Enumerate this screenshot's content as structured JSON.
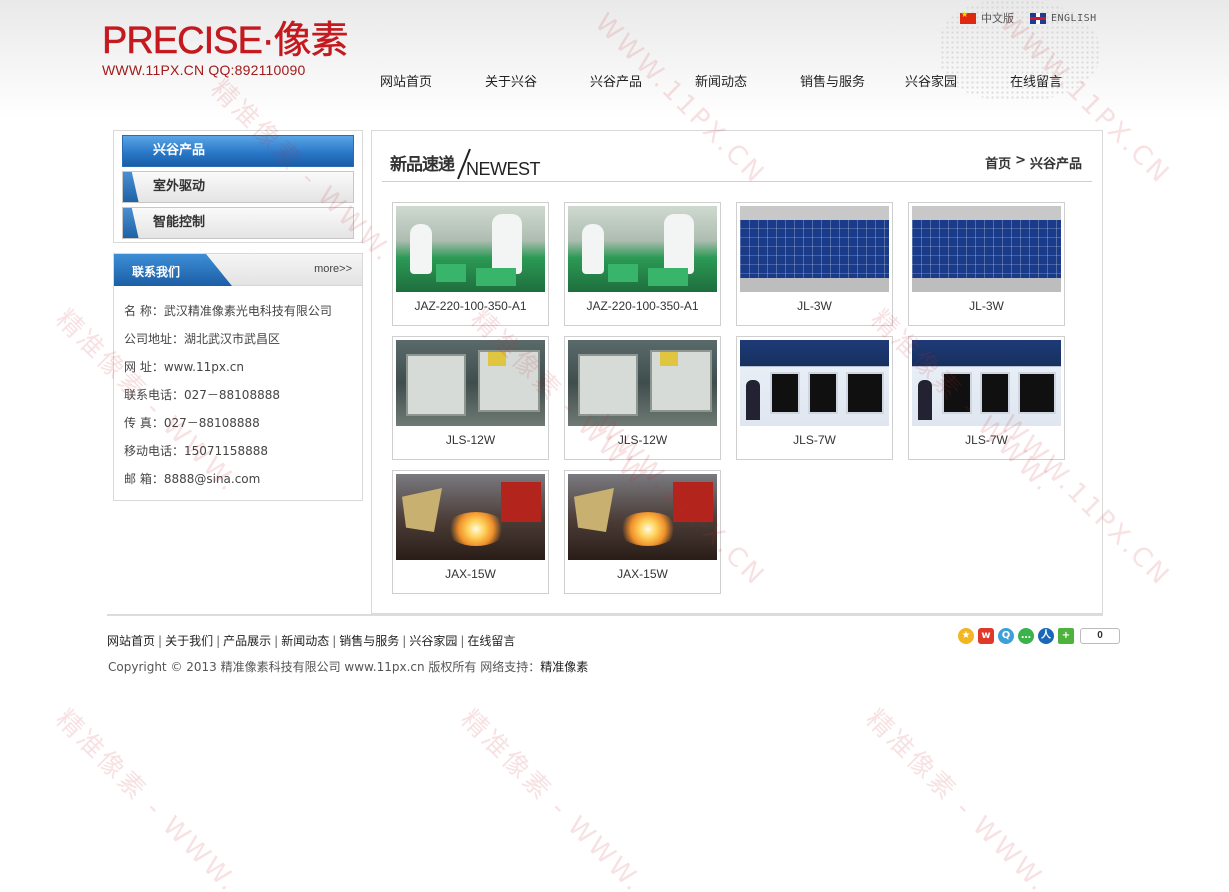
{
  "logo": {
    "title": "PRECISE·像素",
    "subtitle": "WWW.11PX.CN QQ:892110090"
  },
  "lang": {
    "cn": "中文版",
    "en": "ENGLISH"
  },
  "nav": [
    {
      "label": "网站首页"
    },
    {
      "label": "关于兴谷"
    },
    {
      "label": "兴谷产品"
    },
    {
      "label": "新闻动态"
    },
    {
      "label": "销售与服务"
    },
    {
      "label": "兴谷家园"
    },
    {
      "label": "在线留言"
    }
  ],
  "sidebar": {
    "products": [
      {
        "label": "兴谷产品",
        "active": true
      },
      {
        "label": "室外驱动",
        "active": false
      },
      {
        "label": "智能控制",
        "active": false
      }
    ],
    "contact": {
      "title": "联系我们",
      "more": "more>>",
      "lines": [
        "名 称：武汉精准像素光电科技有限公司",
        "公司地址：湖北武汉市武昌区",
        "网 址：www.11px.cn",
        "联系电话：027－88108888",
        "传 真：027－88108888",
        "移动电话：15071158888",
        "邮 箱：8888@sina.com"
      ]
    }
  },
  "main": {
    "title_cn": "新品速递",
    "title_en": "NEWEST",
    "breadcrumb": {
      "home": "首页",
      "sep": ">",
      "current": "兴谷产品"
    },
    "products": [
      {
        "label": "JAZ-220-100-350-A1",
        "image": "factory"
      },
      {
        "label": "JAZ-220-100-350-A1",
        "image": "factory"
      },
      {
        "label": "JL-3W",
        "image": "led"
      },
      {
        "label": "JL-3W",
        "image": "led"
      },
      {
        "label": "JLS-12W",
        "image": "machine"
      },
      {
        "label": "JLS-12W",
        "image": "machine"
      },
      {
        "label": "JLS-7W",
        "image": "booth"
      },
      {
        "label": "JLS-7W",
        "image": "booth"
      },
      {
        "label": "JAX-15W",
        "image": "weld"
      },
      {
        "label": "JAX-15W",
        "image": "weld"
      }
    ]
  },
  "footer": {
    "links": [
      "网站首页",
      "关于我们",
      "产品展示",
      "新闻动态",
      "销售与服务",
      "兴谷家园",
      "在线留言"
    ],
    "copyright": "Copyright © 2013 精准像素科技有限公司 www.11px.cn 版权所有 网络支持：",
    "support": "精准像素",
    "share_count": "0",
    "share_icons": [
      "qzone-icon",
      "weibo-icon",
      "tqq-icon",
      "wechat-icon",
      "renren-icon",
      "more-share-icon"
    ]
  },
  "watermark": {
    "url": "WWW.11PX.CN",
    "brand": "精准像素 - WWW."
  },
  "colors": {
    "accent_blue": "#2a78c8",
    "brand_red": "#c41a1f"
  }
}
